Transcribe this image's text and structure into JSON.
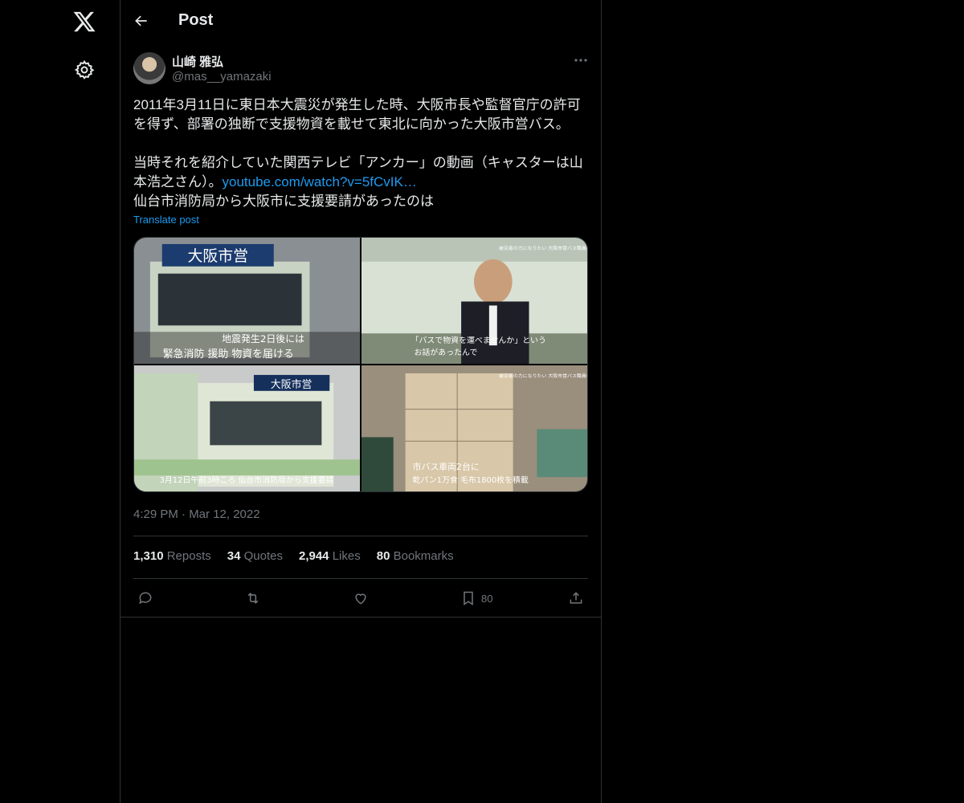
{
  "nav": {
    "logo_icon": "x-logo-icon",
    "settings_icon": "gear-icon"
  },
  "header": {
    "back_icon": "arrow-left-icon",
    "title": "Post"
  },
  "post": {
    "author_name": "山崎 雅弘",
    "author_handle": "@mas__yamazaki",
    "text_part1": "2011年3月11日に東日本大震災が発生した時、大阪市長や監督官庁の許可を得ず、部署の独断で支援物資を載せて東北に向かった大阪市営バス。\n\n当時それを紹介していた関西テレビ「アンカー」の動画（キャスターは山本浩之さん）。",
    "link_text": "youtube.com/watch?v=5fCvIK…",
    "text_part2": "\n仙台市消防局から大阪市に支援要請があったのは",
    "translate_label": "Translate post",
    "timestamp": "4:29 PM · Mar 12, 2022",
    "media": [
      {
        "caption_top": "大阪市営",
        "caption_bottom": "地震発生2日後には",
        "caption_bottom2": "緊急消防 援助 物資を届ける"
      },
      {
        "caption_top": "被災者の力になりたい 大阪市営バス職員の思い",
        "caption_bottom": "「バスで物資を運べませんか」という",
        "caption_bottom2": "お話があったんで"
      },
      {
        "caption_top": "大阪市営",
        "caption_bottom": "3月12日午前3時ころ 仙台市消防局から支援要請"
      },
      {
        "caption_top": "被災者の力になりたい 大阪市営バス職員の思い",
        "caption_bottom": "市バス車両2台に",
        "caption_bottom2": "乾パン1万食 毛布1800枚を積載"
      }
    ]
  },
  "stats": [
    {
      "count": "1,310",
      "label": "Reposts"
    },
    {
      "count": "34",
      "label": "Quotes"
    },
    {
      "count": "2,944",
      "label": "Likes"
    },
    {
      "count": "80",
      "label": "Bookmarks"
    }
  ],
  "actions": {
    "reply_icon": "reply-icon",
    "repost_icon": "repost-icon",
    "like_icon": "heart-icon",
    "bookmark_icon": "bookmark-icon",
    "bookmark_count": "80",
    "share_icon": "share-icon"
  },
  "colors": {
    "background": "#000000",
    "text": "#e7e9ea",
    "muted": "#71767b",
    "link": "#1d9bf0",
    "border": "#2f3336"
  }
}
